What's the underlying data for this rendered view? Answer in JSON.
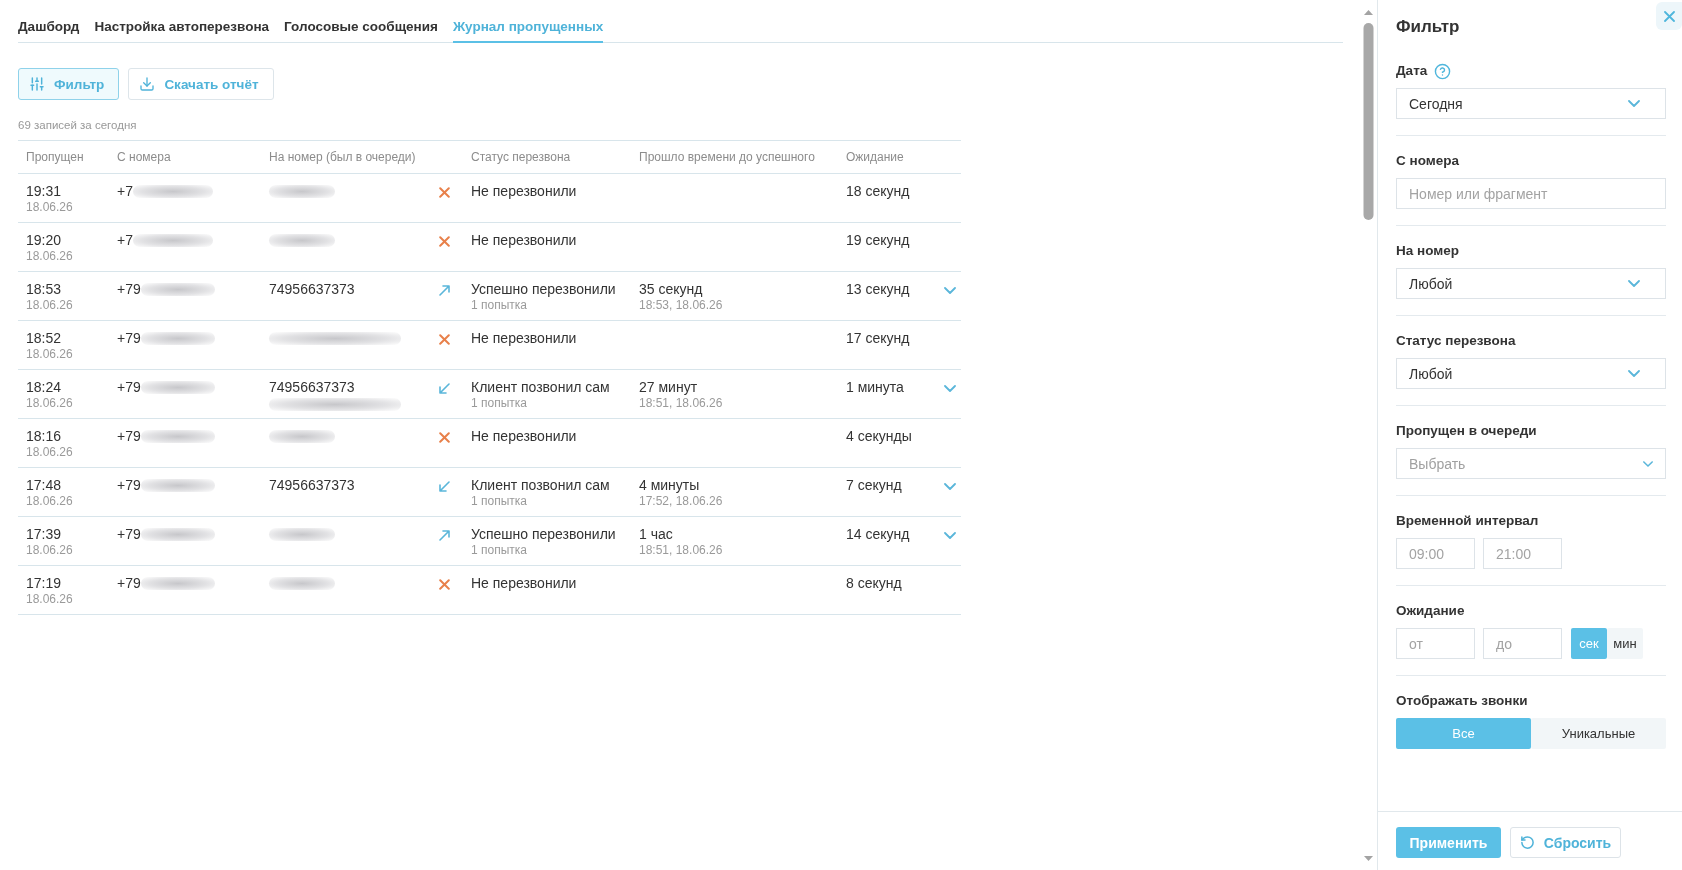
{
  "tabs": [
    {
      "label": "Дашборд",
      "selected": false
    },
    {
      "label": "Настройка автоперезвона",
      "selected": false
    },
    {
      "label": "Голосовые сообщения",
      "selected": false
    },
    {
      "label": "Журнал пропущенных",
      "selected": true
    }
  ],
  "toolbar": {
    "filter_button": {
      "label": "Фильтр",
      "active": true
    },
    "download_button": {
      "label": "Скачать отчёт"
    }
  },
  "record_count": "69 записей за сегодня",
  "table": {
    "columns": [
      "Пропущен",
      "С номера",
      "На номер (был в очереди)",
      "Статус перезвона",
      "Прошло времени до успешного",
      "Ожидание"
    ],
    "rows": [
      {
        "time": "19:31",
        "date": "18.06.26",
        "from": "+7",
        "from_redacted": true,
        "to": {
          "redacted": {
            "kind": "short"
          }
        },
        "status": {
          "kind": "missed",
          "label": "Не перезвонили"
        },
        "wait": "18 секунд",
        "expandable": false
      },
      {
        "time": "19:20",
        "date": "18.06.26",
        "from": "+7",
        "from_redacted": true,
        "to": {
          "redacted": {
            "kind": "short"
          }
        },
        "status": {
          "kind": "missed",
          "label": "Не перезвонили"
        },
        "wait": "19 секунд",
        "expandable": false
      },
      {
        "time": "18:53",
        "date": "18.06.26",
        "from": "+79",
        "from_redacted": true,
        "to": {
          "number": "74956637373"
        },
        "status": {
          "kind": "outgoing",
          "label": "Успешно перезвонили",
          "attempts": "1 попытка"
        },
        "elapsed": "35 секунд",
        "elapsed_at": "18:53, 18.06.26",
        "wait": "13 секунд",
        "expandable": true
      },
      {
        "time": "18:52",
        "date": "18.06.26",
        "from": "+79",
        "from_redacted": true,
        "to": {
          "redacted": {
            "kind": "long"
          }
        },
        "status": {
          "kind": "missed",
          "label": "Не перезвонили"
        },
        "wait": "17 секунд",
        "expandable": false
      },
      {
        "time": "18:24",
        "date": "18.06.26",
        "from": "+79",
        "from_redacted": true,
        "to": {
          "number": "74956637373",
          "redacted": {
            "kind": "long"
          }
        },
        "status": {
          "kind": "incoming",
          "label": "Клиент позвонил сам",
          "attempts": "1 попытка"
        },
        "elapsed": "27 минут",
        "elapsed_at": "18:51, 18.06.26",
        "wait": "1 минута",
        "expandable": true
      },
      {
        "time": "18:16",
        "date": "18.06.26",
        "from": "+79",
        "from_redacted": true,
        "to": {
          "redacted": {
            "kind": "short"
          }
        },
        "status": {
          "kind": "missed",
          "label": "Не перезвонили"
        },
        "wait": "4 секунды",
        "expandable": false
      },
      {
        "time": "17:48",
        "date": "18.06.26",
        "from": "+79",
        "from_redacted": true,
        "to": {
          "number": "74956637373"
        },
        "status": {
          "kind": "incoming",
          "label": "Клиент позвонил сам",
          "attempts": "1 попытка"
        },
        "elapsed": "4 минуты",
        "elapsed_at": "17:52, 18.06.26",
        "wait": "7 секунд",
        "expandable": true
      },
      {
        "time": "17:39",
        "date": "18.06.26",
        "from": "+79",
        "from_redacted": true,
        "to": {
          "redacted": {
            "kind": "short"
          }
        },
        "status": {
          "kind": "outgoing",
          "label": "Успешно перезвонили",
          "attempts": "1 попытка"
        },
        "elapsed": "1 час",
        "elapsed_at": "18:51, 18.06.26",
        "wait": "14 секунд",
        "expandable": true
      },
      {
        "time": "17:19",
        "date": "18.06.26",
        "from": "+79",
        "from_redacted": true,
        "to": {
          "redacted": {
            "kind": "short"
          }
        },
        "status": {
          "kind": "missed",
          "label": "Не перезвонили"
        },
        "wait": "8 секунд",
        "expandable": false
      }
    ]
  },
  "filter_panel": {
    "title": "Фильтр",
    "sections": [
      {
        "kind": "select",
        "label": "Дата",
        "help": true,
        "value": "Сегодня"
      },
      {
        "kind": "input",
        "label": "С номера",
        "placeholder": "Номер или фрагмент"
      },
      {
        "kind": "select",
        "label": "На номер",
        "value": "Любой"
      },
      {
        "kind": "select",
        "label": "Статус перезвона",
        "value": "Любой"
      },
      {
        "kind": "select",
        "label": "Пропущен в очереди",
        "placeholder": "Выбрать"
      },
      {
        "kind": "range",
        "label": "Временной интервал",
        "fields": [
          {
            "placeholder": "09:00"
          },
          {
            "placeholder": "21:00"
          }
        ]
      },
      {
        "kind": "range",
        "label": "Ожидание",
        "fields": [
          {
            "placeholder": "от"
          },
          {
            "placeholder": "до"
          }
        ],
        "units": [
          {
            "label": "сек",
            "selected": true
          },
          {
            "label": "мин",
            "selected": false
          }
        ]
      },
      {
        "kind": "segmented",
        "label": "Отображать звонки",
        "options": [
          {
            "label": "Все",
            "selected": true
          },
          {
            "label": "Уникальные",
            "selected": false
          }
        ]
      }
    ],
    "apply_button": "Применить",
    "reset_button": "Сбросить"
  }
}
